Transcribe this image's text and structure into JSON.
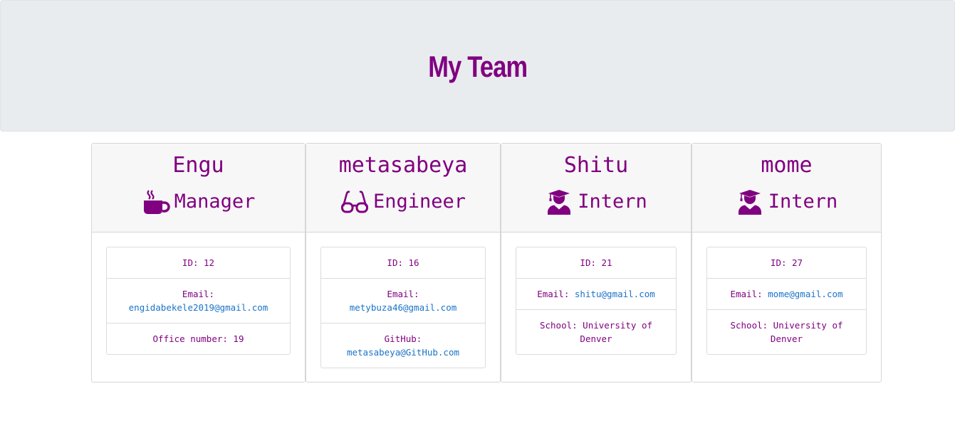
{
  "header": {
    "title": "My Team"
  },
  "team": [
    {
      "name": "Engu",
      "role": "Manager",
      "icon": "coffee-icon",
      "id_label": "ID: 12",
      "email_prefix": "Email:",
      "email": "engidabekele2019@gmail.com",
      "extra_prefix": "Office number: 19",
      "extra_value": ""
    },
    {
      "name": "metasabeya",
      "role": "Engineer",
      "icon": "glasses-icon",
      "id_label": "ID: 16",
      "email_prefix": "Email:",
      "email": "metybuza46@gmail.com",
      "extra_prefix": "GitHub:",
      "extra_value": "metasabeya@GitHub.com"
    },
    {
      "name": "Shitu",
      "role": "Intern",
      "icon": "graduate-icon",
      "id_label": "ID: 21",
      "email_prefix": "Email:",
      "email": "shitu@gmail.com",
      "extra_prefix": "School: University of Denver",
      "extra_value": ""
    },
    {
      "name": "mome",
      "role": "Intern",
      "icon": "graduate-icon",
      "id_label": "ID: 27",
      "email_prefix": "Email:",
      "email": "mome@gmail.com",
      "extra_prefix": "School: University of Denver",
      "extra_value": ""
    }
  ],
  "colors": {
    "accent": "#800080",
    "link": "#1a73c8",
    "header_bg": "#e9ecef"
  }
}
